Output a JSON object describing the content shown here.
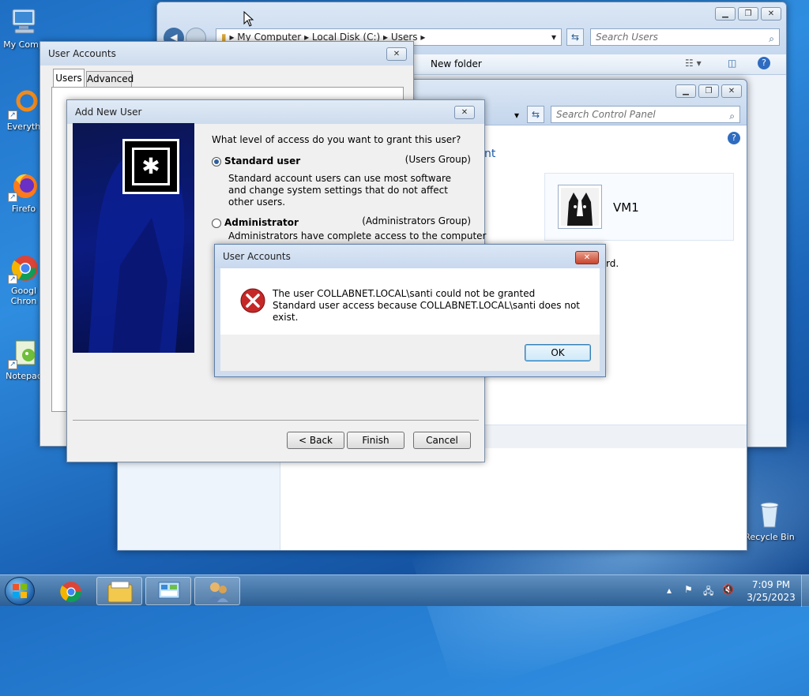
{
  "desktop": {
    "icons": [
      {
        "label": "My Comp",
        "icon": "computer-icon"
      },
      {
        "label": "Everyth",
        "icon": "everything-search-icon"
      },
      {
        "label": "Firefo",
        "icon": "firefox-icon"
      },
      {
        "label": "Googl\nChron",
        "icon": "chrome-icon"
      },
      {
        "label": "Notepac",
        "icon": "notepad-icon"
      },
      {
        "label": "Recycle Bin",
        "icon": "recycle-bin-icon"
      }
    ]
  },
  "explorer": {
    "breadcrumb": [
      "My Computer",
      "Local Disk (C:)",
      "Users"
    ],
    "search_placeholder": "Search Users",
    "new_folder": "New folder"
  },
  "control_panel": {
    "search_placeholder": "Search Control Panel",
    "partial_heading": "nt",
    "account_name": "VM1",
    "partial_text": "rd."
  },
  "user_accounts": {
    "title": "User Accounts",
    "tabs": [
      "Users",
      "Advanced"
    ],
    "active_tab": "Users"
  },
  "add_user": {
    "title": "Add New User",
    "question": "What level of access do you want to grant this user?",
    "options": [
      {
        "label": "Standard user",
        "group": "(Users Group)",
        "desc": "Standard account users can use most software and change system settings that do not affect other users.",
        "selected": true
      },
      {
        "label": "Administrator",
        "group": "(Administrators Group)",
        "desc": "Administrators have complete access to the computer",
        "selected": false
      }
    ],
    "buttons": {
      "back": "< Back",
      "finish": "Finish",
      "cancel": "Cancel"
    }
  },
  "error_dialog": {
    "title": "User Accounts",
    "message": "The user COLLABNET.LOCAL\\santi could not be granted Standard user access because COLLABNET.LOCAL\\santi does not exist.",
    "ok": "OK",
    "icon": "error-icon"
  },
  "taskbar": {
    "clock_time": "7:09 PM",
    "clock_date": "3/25/2023",
    "pinned": [
      "chrome-icon",
      "explorer-icon",
      "control-panel-icon",
      "user-accounts-icon"
    ]
  },
  "colors": {
    "error_red": "#c62828",
    "accent_blue": "#2f8de0"
  }
}
